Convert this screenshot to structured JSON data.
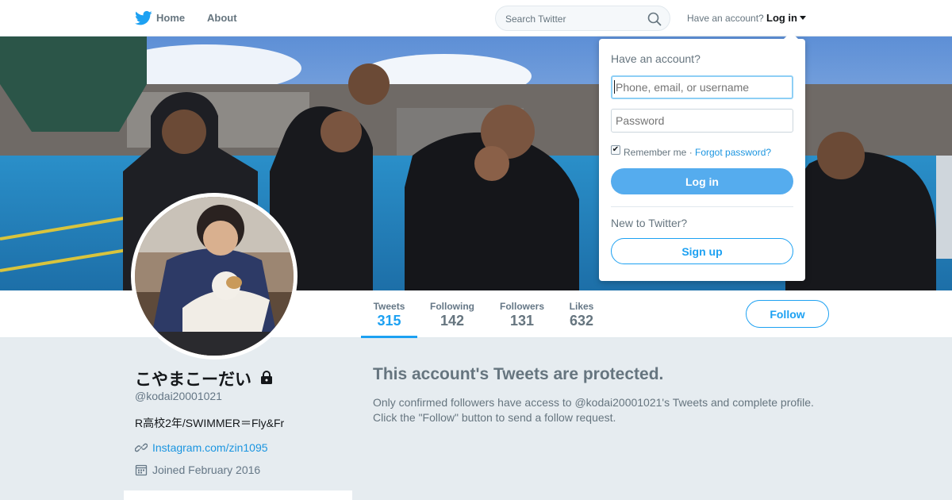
{
  "nav": {
    "home_label": "Home",
    "about_label": "About",
    "search_placeholder": "Search Twitter",
    "have_account": "Have an account?",
    "login_label": "Log in"
  },
  "profile": {
    "name": "こやまこーだい",
    "screen_name": "@kodai20001021",
    "bio": "R高校2年/SWIMMER＝Fly&Fr",
    "website": "Instagram.com/zin1095",
    "joined": "Joined February 2016"
  },
  "stats": [
    {
      "label": "Tweets",
      "value": "315"
    },
    {
      "label": "Following",
      "value": "142"
    },
    {
      "label": "Followers",
      "value": "131"
    },
    {
      "label": "Likes",
      "value": "632"
    }
  ],
  "follow_label": "Follow",
  "protected": {
    "title": "This account's Tweets are protected.",
    "line1": "Only confirmed followers have access to @kodai20001021's Tweets and complete profile.",
    "line2": "Click the \"Follow\" button to send a follow request."
  },
  "login_dropdown": {
    "heading": "Have an account?",
    "username_placeholder": "Phone, email, or username",
    "password_placeholder": "Password",
    "remember_label": "Remember me ·",
    "forgot_label": "Forgot password?",
    "login_button": "Log in",
    "new_label": "New to Twitter?",
    "signup_button": "Sign up"
  },
  "colors": {
    "accent": "#1da1f2",
    "login_button_bg": "#55acee",
    "page_bg": "#e6ecf0"
  }
}
